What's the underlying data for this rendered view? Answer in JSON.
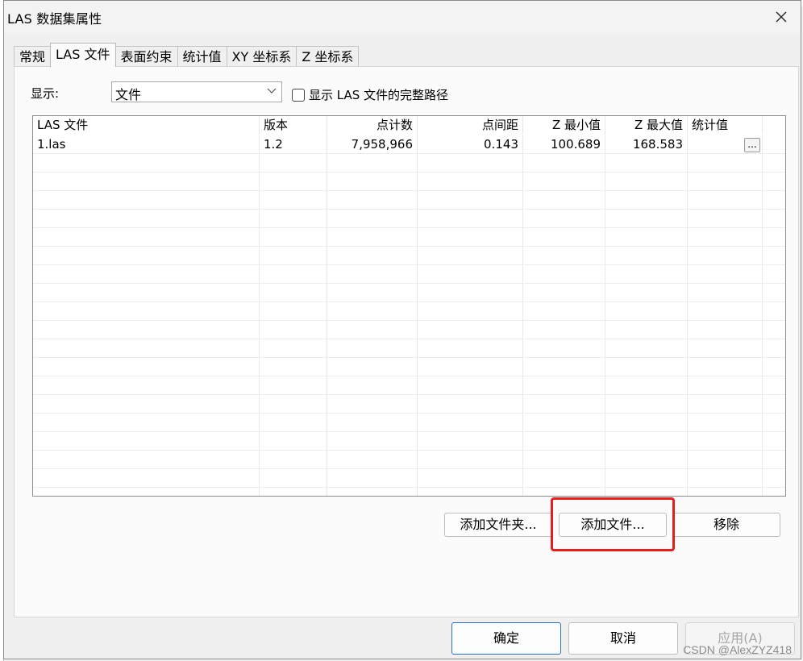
{
  "window": {
    "title": "LAS 数据集属性"
  },
  "tabs": [
    {
      "label": "常规",
      "active": false
    },
    {
      "label": "LAS 文件",
      "active": true
    },
    {
      "label": "表面约束",
      "active": false
    },
    {
      "label": "统计值",
      "active": false
    },
    {
      "label": "XY 坐标系",
      "active": false
    },
    {
      "label": "Z 坐标系",
      "active": false
    }
  ],
  "display": {
    "label": "显示:",
    "selected": "文件",
    "checkbox_label": "显示 LAS 文件的完整路径",
    "checked": false
  },
  "table": {
    "columns": [
      "LAS 文件",
      "版本",
      "点计数",
      "点间距",
      "Z 最小值",
      "Z 最大值",
      "统计值"
    ],
    "rows": [
      [
        "1.las",
        "1.2",
        "7,958,966",
        "0.143",
        "100.689",
        "168.583",
        ""
      ]
    ],
    "stats_button_label": "..."
  },
  "buttons": {
    "add_folder": "添加文件夹...",
    "add_file": "添加文件...",
    "remove": "移除",
    "ok": "确定",
    "cancel": "取消",
    "apply": "应用(A)"
  },
  "accent": {
    "highlight": "#e41e1e",
    "primary_border": "#2a6fc4"
  },
  "watermark": "CSDN @AlexZYZ418"
}
